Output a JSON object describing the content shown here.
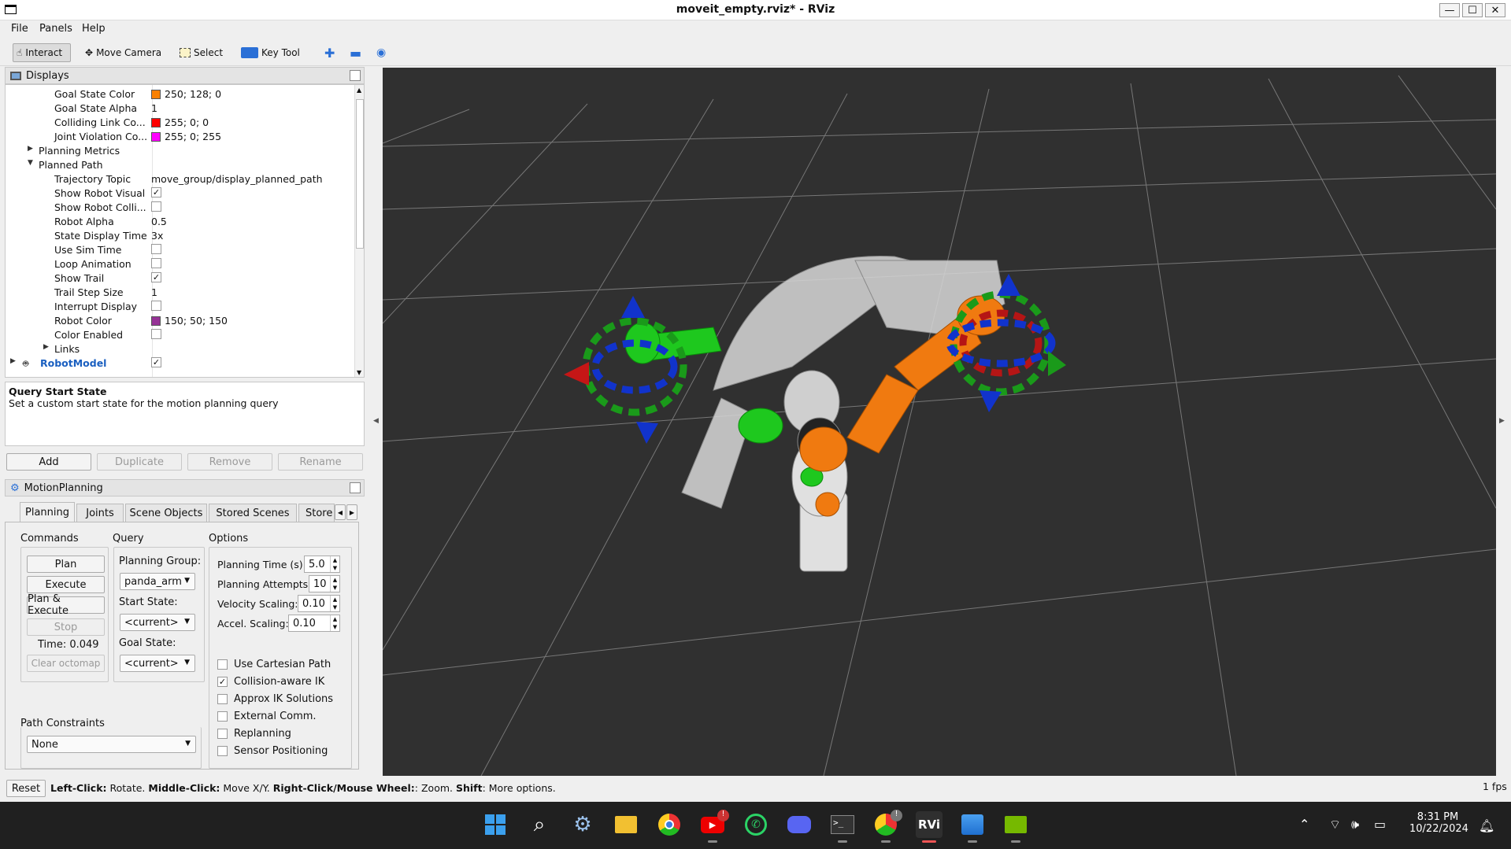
{
  "window": {
    "title": "moveit_empty.rviz* - RViz",
    "min": "—",
    "max": "☐",
    "close": "✕"
  },
  "menu": [
    "File",
    "Panels",
    "Help"
  ],
  "toolbar": {
    "interact": "Interact",
    "move_camera": "Move Camera",
    "select": "Select",
    "key_tool": "Key Tool"
  },
  "displays": {
    "title": "Displays",
    "rows": [
      {
        "label": "Goal State Color",
        "value": "250; 128; 0",
        "swatch": "#fa8000"
      },
      {
        "label": "Goal State Alpha",
        "value": "1"
      },
      {
        "label": "Colliding Link Co...",
        "value": "255; 0; 0",
        "swatch": "#ff0000"
      },
      {
        "label": "Joint Violation Co...",
        "value": "255; 0; 255",
        "swatch": "#ff00ff"
      },
      {
        "label": "Planning Metrics",
        "expander": "collapsed"
      },
      {
        "label": "Planned Path",
        "expander": "expanded"
      },
      {
        "label": "Trajectory Topic",
        "value": "move_group/display_planned_path"
      },
      {
        "label": "Show Robot Visual",
        "check": true
      },
      {
        "label": "Show Robot Colli...",
        "check": false
      },
      {
        "label": "Robot Alpha",
        "value": "0.5"
      },
      {
        "label": "State Display Time",
        "value": "3x"
      },
      {
        "label": "Use Sim Time",
        "check": false
      },
      {
        "label": "Loop Animation",
        "check": false
      },
      {
        "label": "Show Trail",
        "check": true
      },
      {
        "label": "Trail Step Size",
        "value": "1"
      },
      {
        "label": "Interrupt Display",
        "check": false
      },
      {
        "label": "Robot Color",
        "value": "150; 50; 150",
        "swatch": "#963296"
      },
      {
        "label": "Color Enabled",
        "check": false
      },
      {
        "label": "Links",
        "expander": "collapsed"
      },
      {
        "label": "RobotModel",
        "check": true
      }
    ]
  },
  "description": {
    "title": "Query Start State",
    "text": "Set a custom start state for the motion planning query"
  },
  "display_buttons": {
    "add": "Add",
    "duplicate": "Duplicate",
    "remove": "Remove",
    "rename": "Rename"
  },
  "motion_planning": {
    "title": "MotionPlanning",
    "tabs": [
      "Planning",
      "Joints",
      "Scene Objects",
      "Stored Scenes",
      "Store"
    ],
    "commands_label": "Commands",
    "query_label": "Query",
    "options_label": "Options",
    "commands": {
      "plan": "Plan",
      "execute": "Execute",
      "plan_execute": "Plan & Execute",
      "stop": "Stop",
      "time": "Time: 0.049",
      "clear_octomap": "Clear octomap"
    },
    "query": {
      "planning_group_label": "Planning Group:",
      "planning_group": "panda_arm",
      "start_state_label": "Start State:",
      "start_state": "<current>",
      "goal_state_label": "Goal State:",
      "goal_state": "<current>"
    },
    "options": {
      "planning_time_label": "Planning Time (s):",
      "planning_time": "5.0",
      "planning_attempts_label": "Planning Attempts:",
      "planning_attempts": "10",
      "velocity_label": "Velocity Scaling:",
      "velocity": "0.10",
      "accel_label": "Accel. Scaling:",
      "accel": "0.10",
      "checks": [
        {
          "label": "Use Cartesian Path",
          "checked": false
        },
        {
          "label": "Collision-aware IK",
          "checked": true
        },
        {
          "label": "Approx IK Solutions",
          "checked": false
        },
        {
          "label": "External Comm.",
          "checked": false
        },
        {
          "label": "Replanning",
          "checked": false
        },
        {
          "label": "Sensor Positioning",
          "checked": false
        }
      ]
    },
    "path_constraints_label": "Path Constraints",
    "path_constraints": "None"
  },
  "status": {
    "reset": "Reset",
    "segments": [
      {
        "b": "Left-Click:",
        "t": " Rotate. "
      },
      {
        "b": "Middle-Click:",
        "t": " Move X/Y. "
      },
      {
        "b": "Right-Click/Mouse Wheel:",
        "t": ": Zoom. "
      },
      {
        "b": "Shift",
        "t": ": More options."
      }
    ],
    "fps": "1 fps"
  },
  "taskbar": {
    "time": "8:31 PM",
    "date": "10/22/2024",
    "badge1": "!",
    "badge2": "!"
  },
  "colors": {
    "viewport_bg": "#303030",
    "grid": "#7a7a7a",
    "goal_orange": "#f07a10",
    "start_green": "#22cc22",
    "taskbar": "#202020"
  }
}
